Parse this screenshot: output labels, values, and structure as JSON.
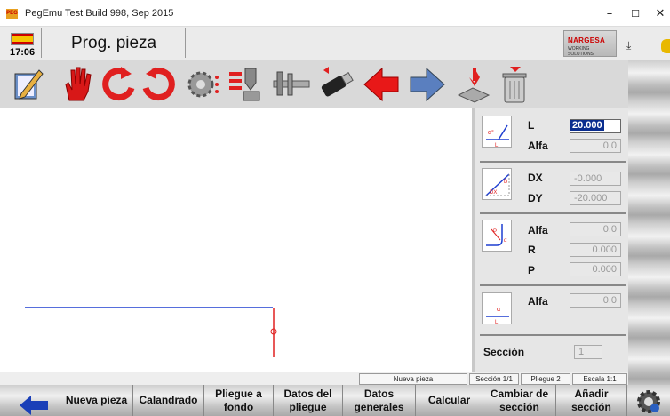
{
  "window": {
    "title": "PegEmu Test Build 998, Sep 2015",
    "app_icon_text": "PEG",
    "minimize_glyph": "–",
    "maximize_glyph": "☐",
    "close_glyph": "✕"
  },
  "header": {
    "clock": "17:06",
    "page_title": "Prog. pieza",
    "logo_text": "NARGESA",
    "logo_sub": "WORKING SOLUTIONS",
    "flag": "flag-spain-icon"
  },
  "toolbar": {
    "buttons": [
      {
        "icon": "edit-pencil-icon"
      },
      {
        "icon": "stop-hand-icon"
      },
      {
        "icon": "rotate-left-icon"
      },
      {
        "icon": "rotate-right-icon"
      },
      {
        "icon": "gear-settings-icon"
      },
      {
        "icon": "tooling-icon"
      },
      {
        "icon": "caliper-icon"
      },
      {
        "icon": "usb-drive-icon"
      },
      {
        "icon": "arrow-left-icon"
      },
      {
        "icon": "arrow-right-icon"
      },
      {
        "icon": "save-to-disk-icon"
      },
      {
        "icon": "trash-can-icon"
      }
    ]
  },
  "panel": {
    "l_label": "L",
    "l_value": "20.000",
    "alfa_label": "Alfa",
    "alfa1_value": "0.0",
    "dx_label": "DX",
    "dx_value": "-0.000",
    "dy_label": "DY",
    "dy_value": "-20.000",
    "alfa2_value": "0.0",
    "r_label": "R",
    "r_value": "0.000",
    "p_label": "P",
    "p_value": "0.000",
    "alfa3_value": "0.0",
    "seccion_label": "Sección",
    "seccion_value": "1"
  },
  "status": {
    "piece": "Nueva pieza",
    "section": "Sección 1/1",
    "bend": "Pliegue 2",
    "scale": "Escala 1:1"
  },
  "bottom": {
    "nueva_pieza": "Nueva pieza",
    "calandrado": "Calandrado",
    "pliegue_fondo_1": "Pliegue a",
    "pliegue_fondo_2": "fondo",
    "datos_pliegue_1": "Datos del",
    "datos_pliegue_2": "pliegue",
    "datos_generales_1": "Datos",
    "datos_generales_2": "generales",
    "calcular": "Calcular",
    "cambiar_seccion_1": "Cambiar de",
    "cambiar_seccion_2": "sección",
    "anadir_seccion_1": "Añadir",
    "anadir_seccion_2": "sección"
  },
  "colors": {
    "profile_blue": "#1f3fd0",
    "profile_red": "#e02020",
    "selection": "#0a2d8f"
  }
}
